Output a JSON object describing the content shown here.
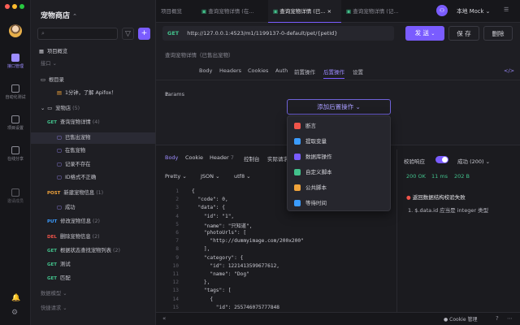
{
  "colors": {
    "accent": "#7a5cff",
    "get": "#42c28c",
    "post": "#f0a33b",
    "put": "#3b9cff",
    "delete": "#f0544a",
    "danger": "#f0544a"
  },
  "rail": {
    "items": [
      {
        "label": "接口管理",
        "icon": "api-icon",
        "active": true
      },
      {
        "label": "自动化测试",
        "icon": "test-icon"
      },
      {
        "label": "项目设置",
        "icon": "settings-icon"
      },
      {
        "label": "在线分享",
        "icon": "share-icon"
      },
      {
        "label": "邀请成员",
        "icon": "invite-icon"
      }
    ]
  },
  "sidebar": {
    "project": "宠物商店",
    "search_placeholder": "",
    "overview": "项目概览",
    "api_section": "接口",
    "root": "根目录",
    "apifox_tip": "1分钟，了解 Apifox！",
    "folder": "宠物店",
    "folder_count": "(5)",
    "tree": [
      {
        "method": "GET",
        "name": "查询宠物详情",
        "count": "(4)"
      },
      {
        "case": "已售出宠物",
        "sel": true
      },
      {
        "case": "在售宠物"
      },
      {
        "case": "记录不存在"
      },
      {
        "case": "ID格式不正确"
      },
      {
        "method": "POST",
        "name": "新建宠物信息",
        "count": "(1)"
      },
      {
        "case": "成功"
      },
      {
        "method": "PUT",
        "name": "修改宠物信息",
        "count": "(2)"
      },
      {
        "method": "DEL",
        "name": "删除宠物信息",
        "count": "(2)"
      },
      {
        "method": "GET",
        "name": "根据状态查找宠物列表",
        "count": "(2)"
      },
      {
        "method": "GET",
        "name": "测试"
      },
      {
        "method": "GET",
        "name": "匹配"
      }
    ],
    "data_models": "数据模型",
    "quick_requests": "快捷请求"
  },
  "tabs": [
    {
      "label": "项目概览"
    },
    {
      "label": "查询宠物详情 (在..."
    },
    {
      "label": "查询宠物详情 (已...",
      "active": true
    },
    {
      "label": "查询宠物详情 (记..."
    }
  ],
  "env": "本地 Mock",
  "request": {
    "method": "GET",
    "url": "http://127.0.0.1:4523/m1/1199137-0-default/pet/{petId}",
    "send": "发 送",
    "save": "保 存",
    "delete": "删除",
    "breadcrumb": "查询宠物详情（已售出宠物）",
    "tabs": [
      {
        "label": "Params",
        "count": "1"
      },
      {
        "label": "Body"
      },
      {
        "label": "Headers"
      },
      {
        "label": "Cookies"
      },
      {
        "label": "Auth"
      },
      {
        "label": "前置操作"
      },
      {
        "label": "后置操作",
        "active": true
      },
      {
        "label": "设置"
      }
    ],
    "add_post_op": "添加后置操作 ⌄"
  },
  "menu": [
    {
      "label": "断言",
      "color": "#f0544a"
    },
    {
      "label": "提取变量",
      "color": "#3b9cff"
    },
    {
      "label": "数据库操作",
      "color": "#7a5cff"
    },
    {
      "label": "自定义脚本",
      "color": "#42c28c"
    },
    {
      "label": "公共脚本",
      "color": "#f0a33b"
    },
    {
      "label": "等待时间",
      "color": "#3b9cff"
    }
  ],
  "response": {
    "tabs": [
      {
        "label": "Body",
        "active": true
      },
      {
        "label": "Cookie"
      },
      {
        "label": "Header",
        "count": "7"
      },
      {
        "label": "控制台"
      },
      {
        "label": "实际请求"
      }
    ],
    "format": [
      "Pretty",
      "JSON",
      "utf8"
    ],
    "validate_label": "校验响应",
    "validate_on": true,
    "status": "成功 (200)",
    "code": "200 OK",
    "time": "11 ms",
    "size": "202 B",
    "error_title": "返回数据结构校验失败",
    "error_detail": "1. $.data.id 应当是 integer 类型",
    "lines": [
      {
        "n": "1",
        "t": "{"
      },
      {
        "n": "2",
        "t": "  \"code\": 0,"
      },
      {
        "n": "3",
        "t": "  \"data\": {"
      },
      {
        "n": "4",
        "t": "    \"id\": \"1\","
      },
      {
        "n": "5",
        "t": "    \"name\": \"只知道\","
      },
      {
        "n": "6",
        "t": "    \"photoUrls\": ["
      },
      {
        "n": "7",
        "t": "      \"http://dummyimage.com/200x200\""
      },
      {
        "n": "8",
        "t": "    ],"
      },
      {
        "n": "9",
        "t": "    \"category\": {"
      },
      {
        "n": "10",
        "t": "      \"id\": 1221413599677612,"
      },
      {
        "n": "11",
        "t": "      \"name\": \"Dog\""
      },
      {
        "n": "12",
        "t": "    },"
      },
      {
        "n": "13",
        "t": "    \"tags\": ["
      },
      {
        "n": "14",
        "t": "      {"
      },
      {
        "n": "15",
        "t": "        \"id\": 255746075777848"
      }
    ]
  },
  "statusbar": {
    "cookie": "Cookie 管理"
  }
}
